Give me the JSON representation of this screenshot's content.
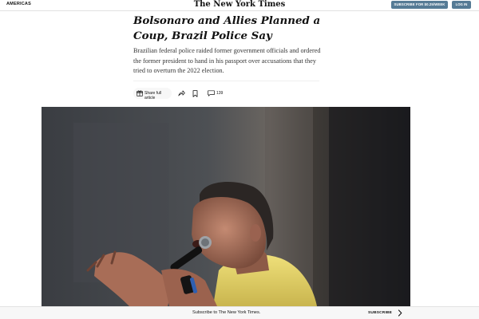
{
  "header": {
    "edition": "AMERICAS",
    "logo": "The New York Times",
    "subscribe_label": "SUBSCRIBE FOR $0.25/WEEK",
    "login_label": "LOG IN"
  },
  "article": {
    "headline": "Bolsonaro and Allies Planned a Coup, Brazil Police Say",
    "summary": "Brazilian federal police raided former government officials and ordered the former president to hand in his passport over accusations that they tried to overturn the 2022 election."
  },
  "share_tools": {
    "share_label": "Share full article",
    "comment_count": "139",
    "icons": [
      "gift-icon",
      "share-icon",
      "bookmark-icon",
      "comment-icon"
    ]
  },
  "banner": {
    "text": "Subscribe to The New York Times.",
    "subscribe_label": "SUBSCRIBE"
  },
  "colors": {
    "accent": "#567b95",
    "shirt": "#e8d86b",
    "text": "#121212"
  }
}
